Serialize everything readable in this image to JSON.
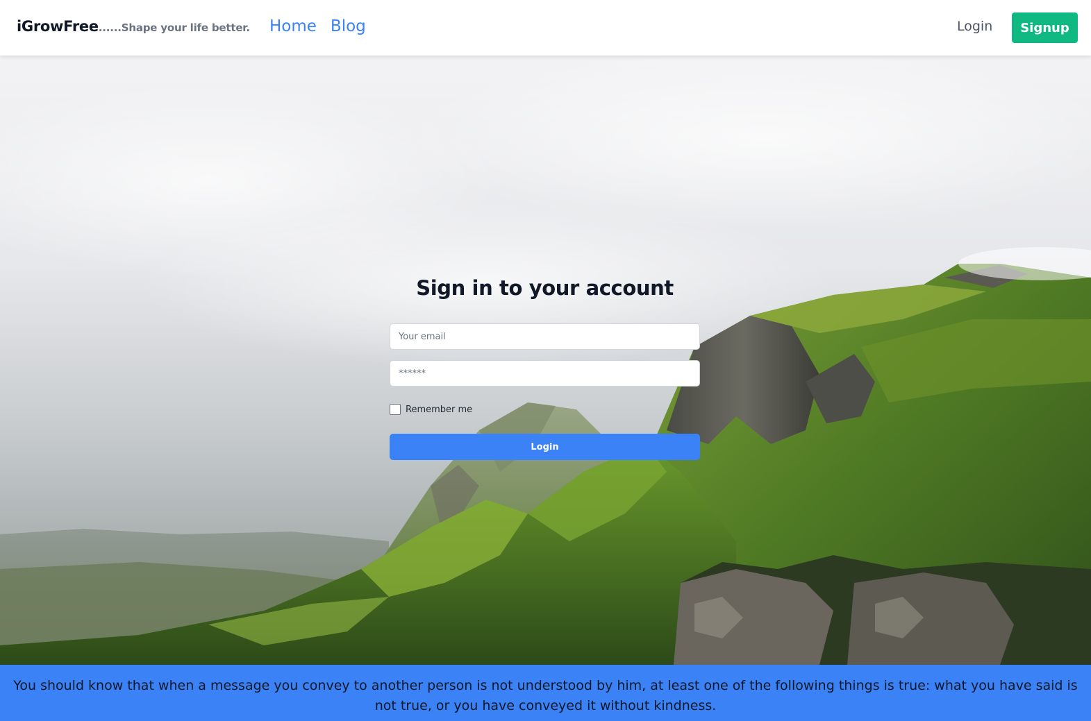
{
  "header": {
    "brand_name": "iGrowFree",
    "brand_tagline": "......Shape your life better.",
    "nav": [
      {
        "label": "Home"
      },
      {
        "label": "Blog"
      }
    ],
    "login_label": "Login",
    "signup_label": "Signup"
  },
  "login_form": {
    "title": "Sign in to your account",
    "email_placeholder": "Your email",
    "email_value": "",
    "password_placeholder": "******",
    "password_value": "",
    "remember_label": "Remember me",
    "remember_checked": false,
    "submit_label": "Login"
  },
  "quote": {
    "text": "You should know that when a message you convey to another person is not understood by him, at least one of the following things is true: what you have said is not true, or you have conveyed it without kindness."
  },
  "colors": {
    "brand_blue": "#3b82f6",
    "signup_green": "#10b981",
    "header_bg": "#ffffff",
    "title_text": "#111827"
  },
  "icons": {
    "remember_checkbox": "checkbox-unchecked-icon"
  }
}
